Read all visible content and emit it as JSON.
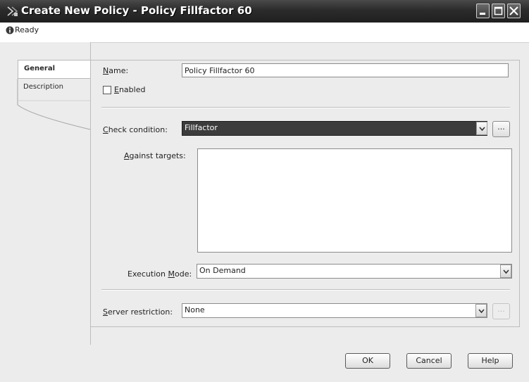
{
  "window": {
    "title": "Create New Policy - Policy Fillfactor 60",
    "status": "Ready",
    "title_icon": "policy-wizard-icon",
    "controls": [
      "minimize-icon",
      "maximize-icon",
      "close-icon"
    ]
  },
  "tabs": [
    {
      "label": "General",
      "selected": true
    },
    {
      "label": "Description",
      "selected": false
    }
  ],
  "form": {
    "name": {
      "label_key": "N",
      "label_rest": "ame:",
      "value": "Policy Fillfactor 60"
    },
    "enabled": {
      "label_key": "E",
      "label_rest": "nabled",
      "checked": false
    },
    "check_condition": {
      "label_key": "C",
      "label_rest": "heck condition:",
      "value": "Fillfactor",
      "button": "..."
    },
    "against_targets": {
      "label_key": "A",
      "label_rest": "gainst targets:"
    },
    "execution_mode": {
      "label_pre": "Execution ",
      "label_key": "M",
      "label_rest": "ode:",
      "value": "On Demand"
    },
    "server_restriction": {
      "label_key": "S",
      "label_rest": "erver restriction:",
      "value": "None",
      "button": "..."
    }
  },
  "buttons": {
    "ok": "OK",
    "cancel": "Cancel",
    "help": "Help"
  },
  "colors": {
    "titlebar": "#2b2b2b",
    "selected_combo": "#3c3c3c",
    "panel": "#ececec"
  }
}
